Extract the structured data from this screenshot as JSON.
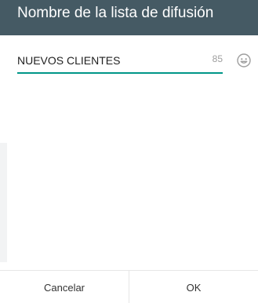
{
  "dialog": {
    "title": "Nombre de la lista de difusión",
    "name_input": {
      "value": "NUEVOS CLIENTES",
      "remaining_chars": "85"
    },
    "emoji_icon": "smiley-face-icon",
    "buttons": {
      "cancel_label": "Cancelar",
      "ok_label": "OK"
    }
  },
  "colors": {
    "header_bg": "#455a64",
    "accent": "#009688"
  }
}
